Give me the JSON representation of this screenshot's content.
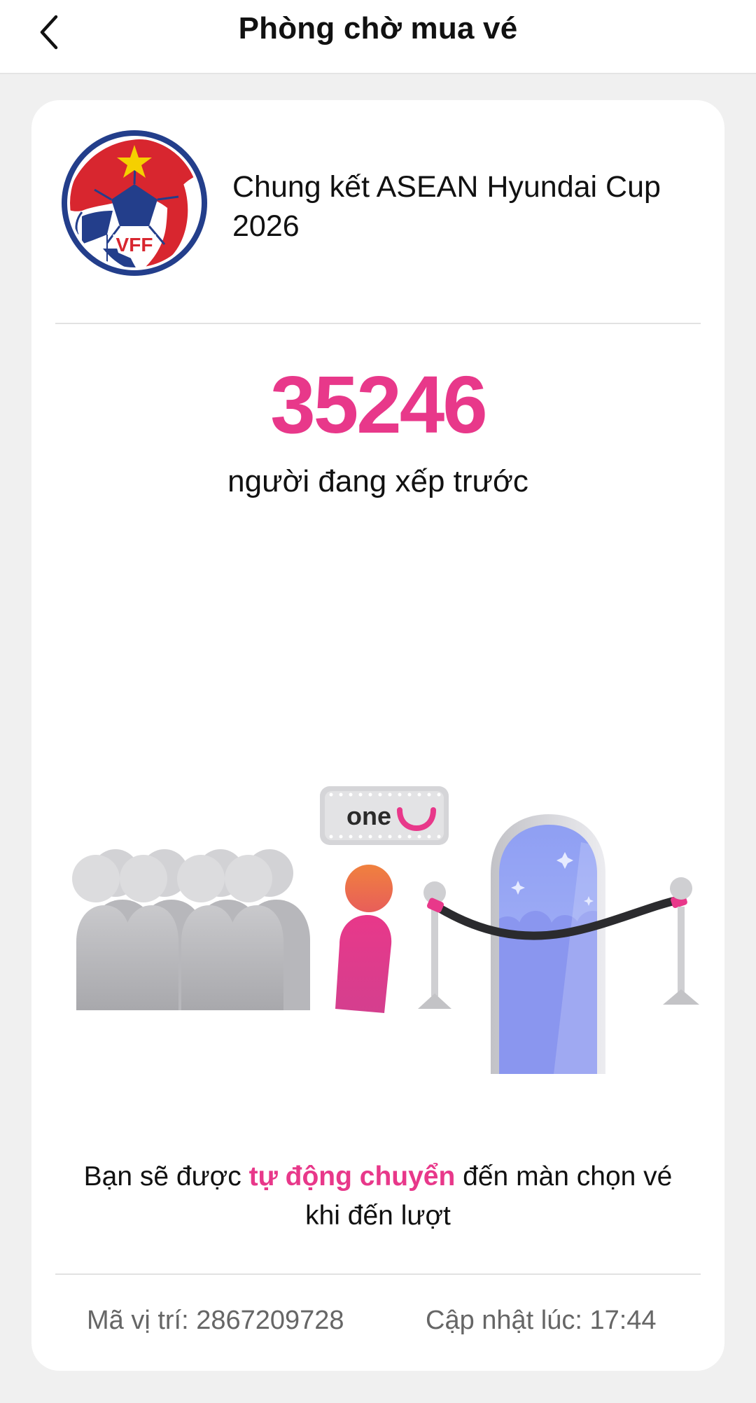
{
  "header": {
    "title": "Phòng chờ mua vé",
    "back_icon": "chevron-left-icon"
  },
  "event": {
    "name": "Chung kết ASEAN Hyundai Cup 2026",
    "logo_text": "VFF"
  },
  "queue": {
    "count": "35246",
    "label": "người đang xếp trước"
  },
  "illustration": {
    "sign_text": "one"
  },
  "info": {
    "prefix": "Bạn sẽ được ",
    "highlight": "tự động chuyển",
    "suffix": " đến màn chọn vé khi đến lượt"
  },
  "footer": {
    "position_code": "Mã vị trí: 2867209728",
    "updated_at": "Cập nhật lúc: 17:44"
  },
  "colors": {
    "accent": "#e8388a",
    "background": "#f0f0f0",
    "card": "#ffffff"
  }
}
